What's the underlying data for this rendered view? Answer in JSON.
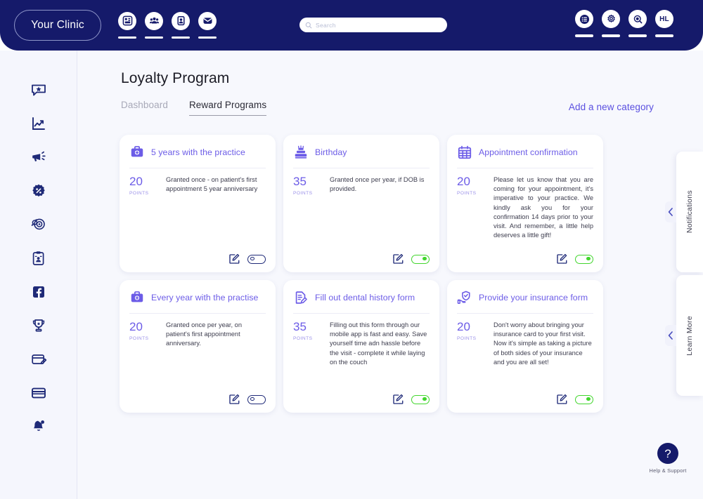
{
  "header": {
    "brand": "Your Clinic",
    "nav_items": [
      {
        "icon": "dashboard-grid-icon"
      },
      {
        "icon": "patients-group-icon"
      },
      {
        "icon": "contact-card-icon"
      },
      {
        "icon": "messages-envelope-icon"
      }
    ],
    "search": {
      "placeholder": "Search",
      "icon": "search-icon"
    },
    "right_items": [
      {
        "icon": "list-menu-icon"
      },
      {
        "icon": "gear-icon"
      },
      {
        "icon": "magnifier-icon"
      },
      {
        "icon": "avatar",
        "initials": "HL"
      }
    ]
  },
  "sidebar": {
    "items": [
      {
        "icon": "review-star-chat-icon"
      },
      {
        "icon": "analytics-chart-icon"
      },
      {
        "icon": "megaphone-icon"
      },
      {
        "icon": "discount-badge-icon"
      },
      {
        "icon": "target-reach-icon"
      },
      {
        "icon": "clipboard-patient-icon"
      },
      {
        "icon": "facebook-icon"
      },
      {
        "icon": "trophy-loyalty-icon"
      },
      {
        "icon": "card-edit-icon"
      },
      {
        "icon": "credit-card-icon"
      },
      {
        "icon": "bell-notification-icon"
      }
    ]
  },
  "main": {
    "title": "Loyalty Program",
    "tabs": [
      {
        "label": "Dashboard",
        "active": false
      },
      {
        "label": "Reward Programs",
        "active": true
      }
    ],
    "add_category_label": "Add a new category",
    "points_label": "POINTS",
    "cards": [
      {
        "icon": "medical-bag-icon",
        "title": "5 years with the practice",
        "points": "20",
        "description": "Granted once - on patient's first appointment 5 year anniversary",
        "justify": false,
        "toggle_on": false
      },
      {
        "icon": "birthday-cake-icon",
        "title": "Birthday",
        "points": "35",
        "description": "Granted once per year, if DOB is provided.",
        "justify": false,
        "toggle_on": true
      },
      {
        "icon": "calendar-icon",
        "title": "Appointment confirmation",
        "points": "20",
        "description": "Please let us know that you are coming for your appointment, it's imperative to your practice. We kindly ask you for your confirmation 14 days prior to your visit. And remember, a little help deserves a little gift!",
        "justify": true,
        "toggle_on": true
      },
      {
        "icon": "medical-bag-icon",
        "title": "Every year with the practise",
        "points": "20",
        "description": "Granted once per year, on patient's first appointment anniversary.",
        "justify": false,
        "toggle_on": false
      },
      {
        "icon": "form-pencil-icon",
        "title": "Fill out dental history form",
        "points": "35",
        "description": "Filling out this form through our mobile app is fast and easy. Save yourself time adn hassle before the visit - complete it while laying on the couch",
        "justify": false,
        "toggle_on": true
      },
      {
        "icon": "insurance-shield-hand-icon",
        "title": "Provide your insurance form",
        "points": "20",
        "description": "Don't worry about bringing your insurance card to your first visit. Now it's simple as taking a picture of both sides of your insurance and you are all set!",
        "justify": false,
        "toggle_on": true
      }
    ]
  },
  "side_panels": [
    {
      "label": "Notifications",
      "icon": "chevron-left-icon"
    },
    {
      "label": "Learn More",
      "icon": "chevron-left-icon"
    }
  ],
  "help_widget": {
    "label": "Help & Support",
    "glyph": "?"
  },
  "colors": {
    "header_navy": "#151a6a",
    "accent_purple": "#6c5ce7",
    "toggle_on_green": "#41d62c",
    "page_bg": "#f7f8fd",
    "sidebar_bg": "#f5f6fd"
  }
}
